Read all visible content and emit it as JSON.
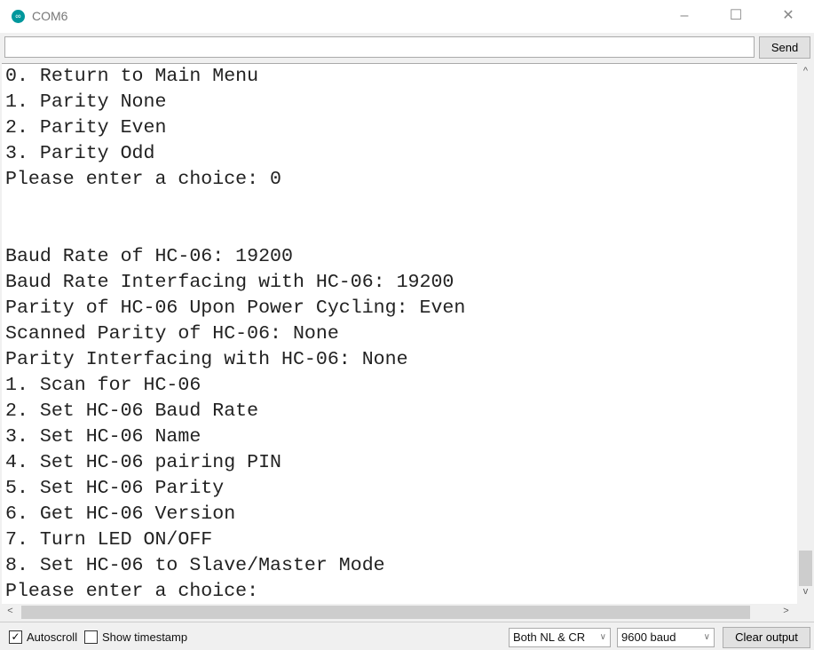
{
  "window": {
    "title": "COM6",
    "icon": "arduino-logo-icon",
    "minimize": "–",
    "maximize": "☐",
    "close": "✕"
  },
  "input": {
    "value": "",
    "send_label": "Send"
  },
  "output": {
    "lines": [
      "0. Return to Main Menu",
      "1. Parity None",
      "2. Parity Even",
      "3. Parity Odd",
      "Please enter a choice: 0",
      "",
      "",
      "Baud Rate of HC-06: 19200",
      "Baud Rate Interfacing with HC-06: 19200",
      "Parity of HC-06 Upon Power Cycling: Even",
      "Scanned Parity of HC-06: None",
      "Parity Interfacing with HC-06: None",
      "1. Scan for HC-06",
      "2. Set HC-06 Baud Rate",
      "3. Set HC-06 Name",
      "4. Set HC-06 pairing PIN",
      "5. Set HC-06 Parity",
      "6. Get HC-06 Version",
      "7. Turn LED ON/OFF",
      "8. Set HC-06 to Slave/Master Mode",
      "Please enter a choice:"
    ]
  },
  "footer": {
    "autoscroll_label": "Autoscroll",
    "autoscroll_checked": true,
    "timestamp_label": "Show timestamp",
    "timestamp_checked": false,
    "line_ending": "Both NL & CR",
    "baud": "9600 baud",
    "clear_label": "Clear output"
  }
}
